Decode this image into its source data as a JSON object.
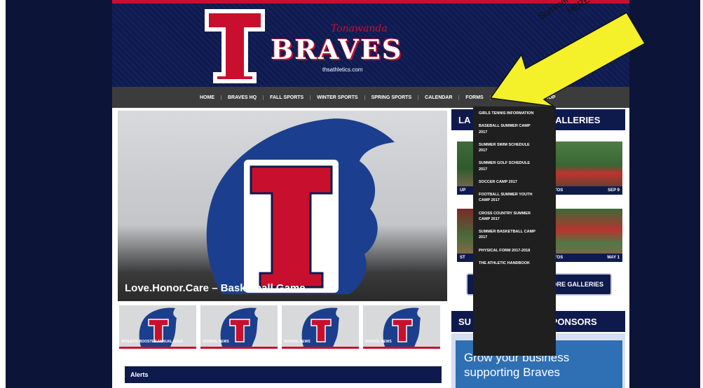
{
  "header": {
    "logo_letter": "T",
    "school_script": "Tonawanda",
    "brand": "BRAVES",
    "site_url": "thsathletics.com"
  },
  "nav": {
    "items": [
      "HOME",
      "BRAVES HQ",
      "FALL SPORTS",
      "WINTER SPORTS",
      "SPRING SPORTS",
      "CALENDAR",
      "FORMS",
      "SHOP"
    ]
  },
  "hero": {
    "caption": "Love.Honor.Care – Basketball Game"
  },
  "thumbs": [
    {
      "caption": "ATHLETIC BOOSTER ANNUAL GOLF"
    },
    {
      "caption": "SCHOOL NEWS"
    },
    {
      "caption": "SCHOOL NEWS"
    },
    {
      "caption": "SCHOOL NEWS"
    }
  ],
  "alerts": {
    "title": "Alerts"
  },
  "sidebar": {
    "galleries_title_left": "LA",
    "galleries_title_right": "GALLERIES",
    "photos": [
      {
        "label_left": "UP",
        "label_right": "SEP 9",
        "label_mid": "PHOTOS"
      },
      {
        "label_left": "ST",
        "label_right": "MAY 1",
        "label_mid": "PHOTOS"
      }
    ],
    "more_button": "MORE GALLERIES",
    "sponsors_title_left": "SU",
    "sponsors_title_right": "SPONSORS",
    "sponsor_ad": "Grow your business supporting Braves"
  },
  "dropdown": {
    "items": [
      "GIRLS TENNIS INFORMATION",
      "BASEBALL SUMMER CAMP 2017",
      "SUMMER SWIM SCHEDULE 2017",
      "SUMMER GOLF SCHEDULE 2017",
      "SOCCER CAMP 2017",
      "FOOTBALL SUMMER YOUTH CAMP 2017",
      "CROSS COUNTRY SUMMER CAMP 2017",
      "SUMMER BASKETBALL CAMP 2017",
      "PHYSICAL FORM 2017-2018",
      "THE ATHLETIC HANDBOOK"
    ]
  },
  "annotation": {
    "line1": "Summer Camp Info",
    "line2": "HERE"
  },
  "colors": {
    "navy": "#0f1a4c",
    "red": "#c8102e",
    "nav_gray": "#3d3c3c",
    "arrow_yellow": "#f4f02a"
  }
}
